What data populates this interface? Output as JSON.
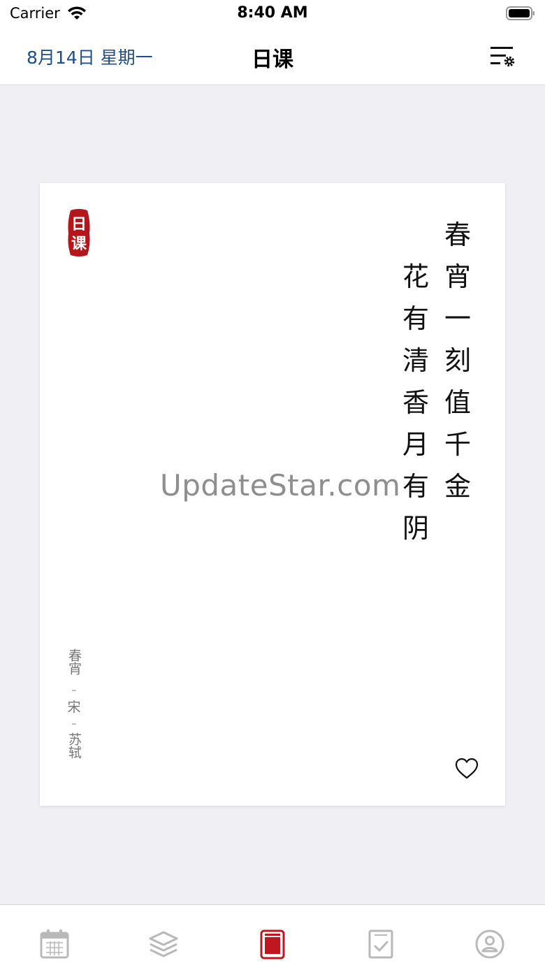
{
  "status_bar": {
    "carrier": "Carrier",
    "time": "8:40 AM"
  },
  "nav": {
    "date": "8月14日 星期一",
    "title": "日课",
    "settings_icon": "list-settings-icon"
  },
  "card": {
    "seal_text": [
      "日",
      "课"
    ],
    "poem_columns": [
      [
        "春",
        "宵",
        "一",
        "刻",
        "值",
        "千",
        "金"
      ],
      [
        "花",
        "有",
        "清",
        "香",
        "月",
        "有",
        "阴"
      ]
    ],
    "watermark": "UpdateStar.com",
    "author": {
      "title": "春宵",
      "dynasty": "宋",
      "poet": "苏轼"
    },
    "favorite_icon": "heart-icon"
  },
  "tabbar": {
    "tabs": [
      {
        "icon": "calendar-icon",
        "active": false
      },
      {
        "icon": "layers-icon",
        "active": false
      },
      {
        "icon": "book-icon",
        "active": true
      },
      {
        "icon": "checklist-icon",
        "active": false
      },
      {
        "icon": "profile-icon",
        "active": false
      }
    ]
  },
  "colors": {
    "accent": "#1f4e8c",
    "seal_red": "#b5161b",
    "active_tab": "#c0161e",
    "inactive_tab": "#b9b9b9",
    "background": "#efeff4"
  }
}
